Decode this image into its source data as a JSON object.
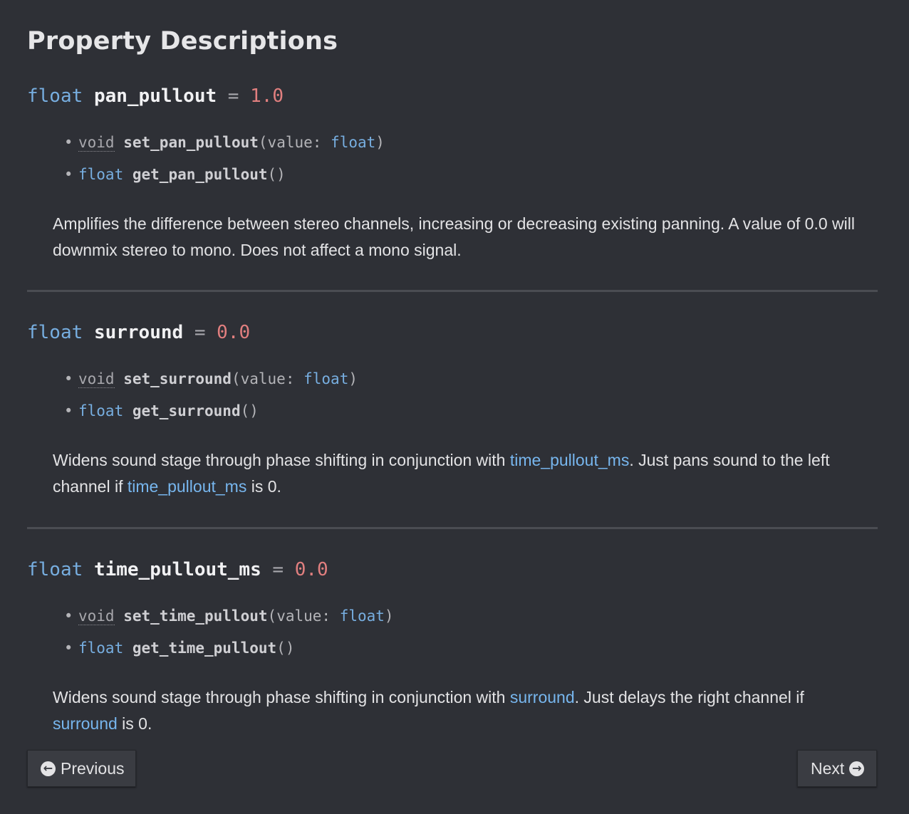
{
  "heading": "Property Descriptions",
  "properties": [
    {
      "type": "float",
      "name": "pan_pullout",
      "eq": "=",
      "default": "1.0",
      "setter": {
        "ret": "void",
        "name": "set_pan_pullout",
        "open": "(",
        "param": "value:",
        "ptype": "float",
        "close": ")"
      },
      "getter": {
        "ret": "float",
        "name": "get_pan_pullout",
        "parens": "()"
      },
      "desc_text": "Amplifies the difference between stereo channels, increasing or decreasing existing panning. A value of 0.0 will downmix stereo to mono. Does not affect a mono signal."
    },
    {
      "type": "float",
      "name": "surround",
      "eq": "=",
      "default": "0.0",
      "setter": {
        "ret": "void",
        "name": "set_surround",
        "open": "(",
        "param": "value:",
        "ptype": "float",
        "close": ")"
      },
      "getter": {
        "ret": "float",
        "name": "get_surround",
        "parens": "()"
      },
      "desc_a": "Widens sound stage through phase shifting in conjunction with ",
      "link1": "time_pullout_ms",
      "desc_b": ". Just pans sound to the left channel if ",
      "link2": "time_pullout_ms",
      "desc_c": " is 0."
    },
    {
      "type": "float",
      "name": "time_pullout_ms",
      "eq": "=",
      "default": "0.0",
      "setter": {
        "ret": "void",
        "name": "set_time_pullout",
        "open": "(",
        "param": "value:",
        "ptype": "float",
        "close": ")"
      },
      "getter": {
        "ret": "float",
        "name": "get_time_pullout",
        "parens": "()"
      },
      "desc_a": "Widens sound stage through phase shifting in conjunction with ",
      "link1": "surround",
      "desc_b": ". Just delays the right channel if ",
      "link2": "surround",
      "desc_c": " is 0."
    }
  ],
  "nav": {
    "previous_label": "Previous",
    "next_label": "Next",
    "previous_icon": "circle-arrow-left-icon",
    "next_icon": "circle-arrow-right-icon"
  },
  "colors": {
    "background": "#2e3036",
    "type": "#77aee0",
    "default_value": "#e17f7f",
    "link": "#77b6ee"
  }
}
